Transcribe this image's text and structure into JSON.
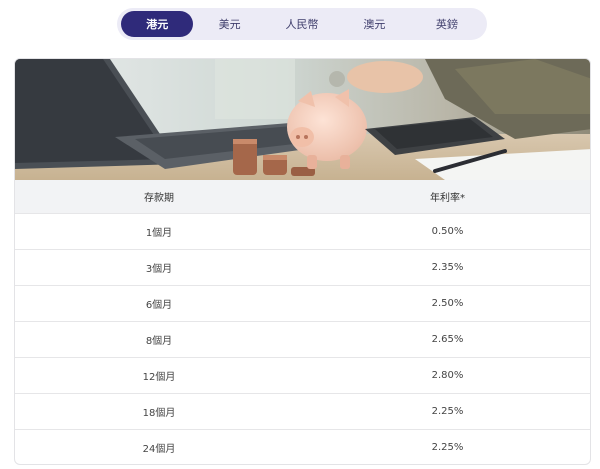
{
  "currency_tabs": [
    {
      "label": "港元",
      "active": true
    },
    {
      "label": "美元",
      "active": false
    },
    {
      "label": "人民幣",
      "active": false
    },
    {
      "label": "澳元",
      "active": false
    },
    {
      "label": "英鎊",
      "active": false
    }
  ],
  "banner": {
    "image": "piggy-bank-savings-photo"
  },
  "table": {
    "headers": {
      "term": "存款期",
      "rate": "年利率*"
    },
    "rows": [
      {
        "term": "1個月",
        "rate": "0.50%"
      },
      {
        "term": "3個月",
        "rate": "2.35%"
      },
      {
        "term": "6個月",
        "rate": "2.50%"
      },
      {
        "term": "8個月",
        "rate": "2.65%"
      },
      {
        "term": "12個月",
        "rate": "2.80%"
      },
      {
        "term": "18個月",
        "rate": "2.25%"
      },
      {
        "term": "24個月",
        "rate": "2.25%"
      }
    ]
  },
  "colors": {
    "accent": "#2f2a7a",
    "tab_bg": "#ecebf6",
    "header_bg": "#f2f3f5"
  }
}
